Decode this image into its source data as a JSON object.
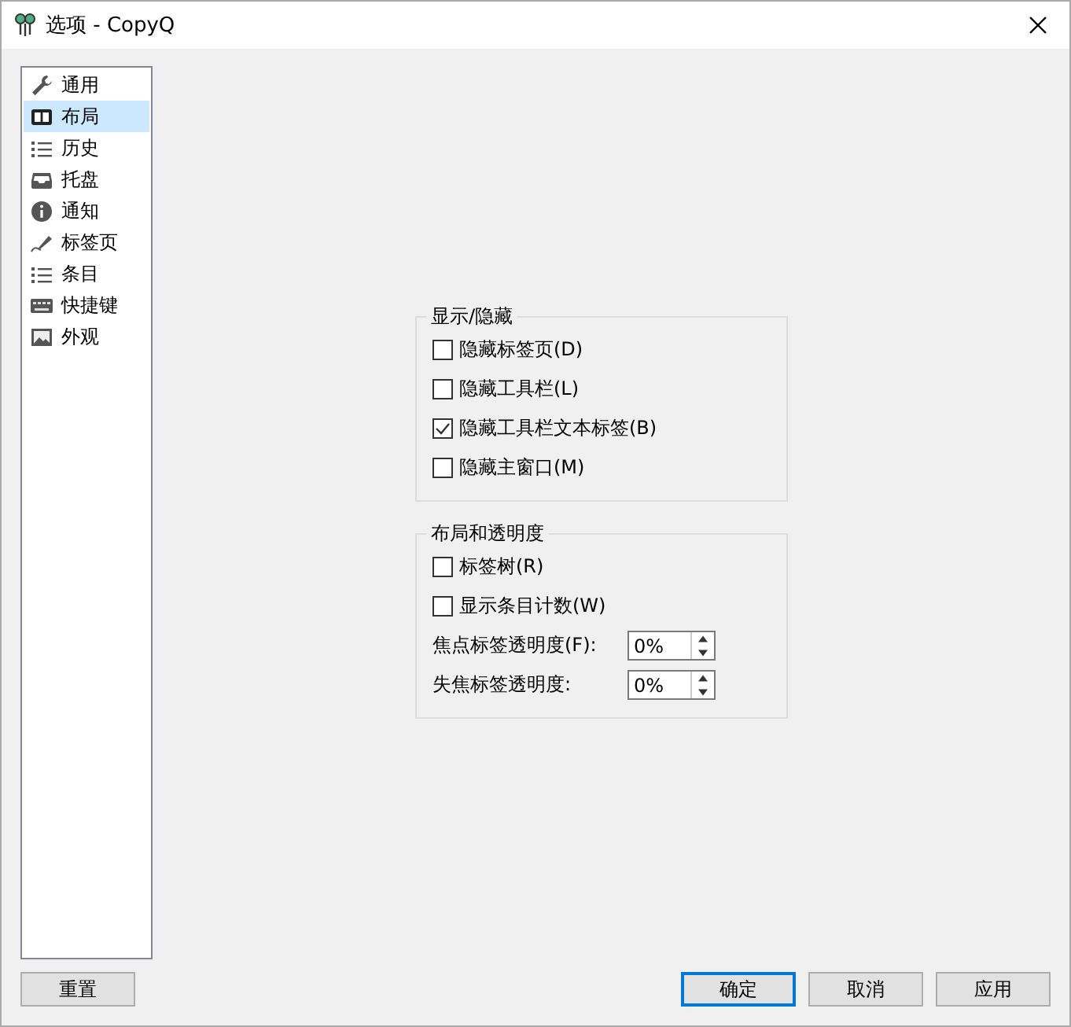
{
  "window": {
    "title": "选项 - CopyQ"
  },
  "sidebar": {
    "items": [
      {
        "label": "通用",
        "selected": false
      },
      {
        "label": "布局",
        "selected": true
      },
      {
        "label": "历史",
        "selected": false
      },
      {
        "label": "托盘",
        "selected": false
      },
      {
        "label": "通知",
        "selected": false
      },
      {
        "label": "标签页",
        "selected": false
      },
      {
        "label": "条目",
        "selected": false
      },
      {
        "label": "快捷键",
        "selected": false
      },
      {
        "label": "外观",
        "selected": false
      }
    ]
  },
  "groups": [
    {
      "title": "显示/隐藏",
      "rows": [
        {
          "kind": "checkbox",
          "label": "隐藏标签页(D)",
          "checked": false
        },
        {
          "kind": "checkbox",
          "label": "隐藏工具栏(L)",
          "checked": false
        },
        {
          "kind": "checkbox",
          "label": "隐藏工具栏文本标签(B)",
          "checked": true
        },
        {
          "kind": "checkbox",
          "label": "隐藏主窗口(M)",
          "checked": false
        }
      ]
    },
    {
      "title": "布局和透明度",
      "rows": [
        {
          "kind": "checkbox",
          "label": "标签树(R)",
          "checked": false
        },
        {
          "kind": "checkbox",
          "label": "显示条目计数(W)",
          "checked": false
        },
        {
          "kind": "spin",
          "label": "焦点标签透明度(F):",
          "value": "0%"
        },
        {
          "kind": "spin",
          "label": "失焦标签透明度:",
          "value": "0%"
        }
      ]
    }
  ],
  "buttons": {
    "reset": "重置",
    "actions": [
      {
        "label": "确定",
        "default": true
      },
      {
        "label": "取消",
        "default": false
      },
      {
        "label": "应用",
        "default": false
      }
    ]
  }
}
